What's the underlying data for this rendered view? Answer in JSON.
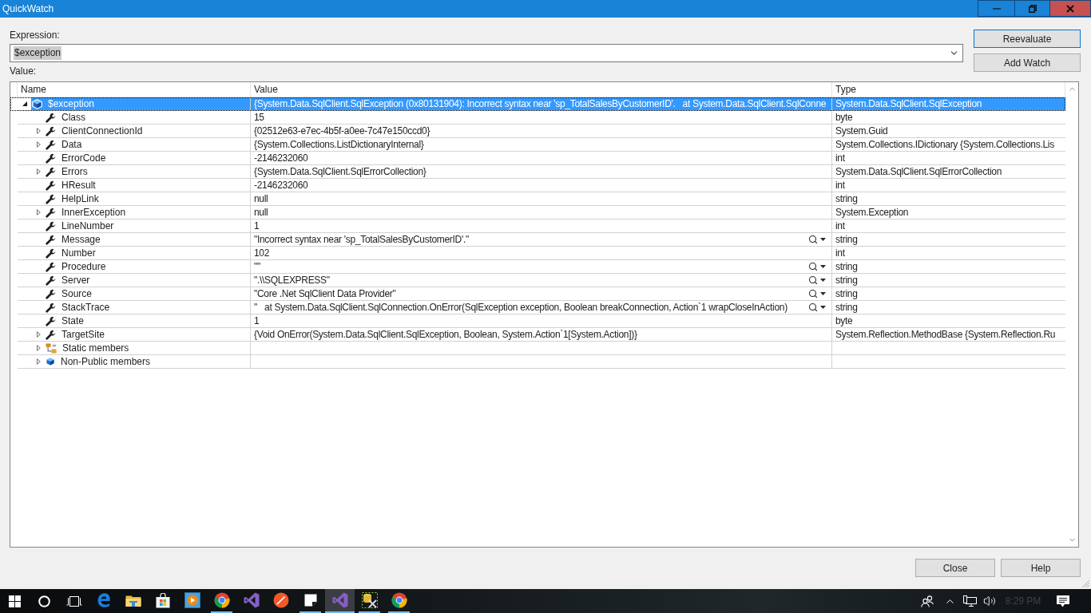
{
  "window": {
    "title": "QuickWatch"
  },
  "expression": {
    "label": "Expression:",
    "value": "$exception",
    "value_selected": true
  },
  "actions": [
    {
      "label": "Reevaluate",
      "default": true
    },
    {
      "label": "Add Watch",
      "default": false
    }
  ],
  "value_label": "Value:",
  "grid": {
    "columns": [
      "Name",
      "Value",
      "Type"
    ],
    "rows": [
      {
        "name": "$exception",
        "value": "{System.Data.SqlClient.SqlException (0x80131904): Incorrect syntax near 'sp_TotalSalesByCustomerID'.   at System.Data.SqlClient.SqlConne",
        "type": "System.Data.SqlClient.SqlException",
        "kind": "exception",
        "expandable": true,
        "expanded": true,
        "selected": true,
        "visualizer": false,
        "children": [
          {
            "name": "Class",
            "value": "15",
            "type": "byte",
            "kind": "property",
            "expandable": false,
            "selected": false,
            "visualizer": false
          },
          {
            "name": "ClientConnectionId",
            "value": "{02512e63-e7ec-4b5f-a0ee-7c47e150ccd0}",
            "type": "System.Guid",
            "kind": "property",
            "expandable": true,
            "expanded": false,
            "selected": false,
            "visualizer": false
          },
          {
            "name": "Data",
            "value": "{System.Collections.ListDictionaryInternal}",
            "type": "System.Collections.IDictionary {System.Collections.Lis",
            "kind": "property",
            "expandable": true,
            "expanded": false,
            "selected": false,
            "visualizer": false
          },
          {
            "name": "ErrorCode",
            "value": "-2146232060",
            "type": "int",
            "kind": "property",
            "expandable": false,
            "selected": false,
            "visualizer": false
          },
          {
            "name": "Errors",
            "value": "{System.Data.SqlClient.SqlErrorCollection}",
            "type": "System.Data.SqlClient.SqlErrorCollection",
            "kind": "property",
            "expandable": true,
            "expanded": false,
            "selected": false,
            "visualizer": false
          },
          {
            "name": "HResult",
            "value": "-2146232060",
            "type": "int",
            "kind": "property",
            "expandable": false,
            "selected": false,
            "visualizer": false
          },
          {
            "name": "HelpLink",
            "value": "null",
            "type": "string",
            "kind": "property",
            "expandable": false,
            "selected": false,
            "visualizer": false
          },
          {
            "name": "InnerException",
            "value": "null",
            "type": "System.Exception",
            "kind": "property",
            "expandable": true,
            "expanded": false,
            "selected": false,
            "visualizer": false
          },
          {
            "name": "LineNumber",
            "value": "1",
            "type": "int",
            "kind": "property",
            "expandable": false,
            "selected": false,
            "visualizer": false
          },
          {
            "name": "Message",
            "value": "\"Incorrect syntax near 'sp_TotalSalesByCustomerID'.\"",
            "type": "string",
            "kind": "property",
            "expandable": false,
            "selected": false,
            "visualizer": true
          },
          {
            "name": "Number",
            "value": "102",
            "type": "int",
            "kind": "property",
            "expandable": false,
            "selected": false,
            "visualizer": false
          },
          {
            "name": "Procedure",
            "value": "\"\"",
            "type": "string",
            "kind": "property",
            "expandable": false,
            "selected": false,
            "visualizer": true
          },
          {
            "name": "Server",
            "value": "\".\\\\SQLEXPRESS\"",
            "type": "string",
            "kind": "property",
            "expandable": false,
            "selected": false,
            "visualizer": true
          },
          {
            "name": "Source",
            "value": "\"Core .Net SqlClient Data Provider\"",
            "type": "string",
            "kind": "property",
            "expandable": false,
            "selected": false,
            "visualizer": true
          },
          {
            "name": "StackTrace",
            "value": "\"   at System.Data.SqlClient.SqlConnection.OnError(SqlException exception, Boolean breakConnection, Action`1 wrapCloseInAction)",
            "type": "string",
            "kind": "property",
            "expandable": false,
            "selected": false,
            "visualizer": true
          },
          {
            "name": "State",
            "value": "1",
            "type": "byte",
            "kind": "property",
            "expandable": false,
            "selected": false,
            "visualizer": false
          },
          {
            "name": "TargetSite",
            "value": "{Void OnError(System.Data.SqlClient.SqlException, Boolean, System.Action`1[System.Action])}",
            "type": "System.Reflection.MethodBase {System.Reflection.Ru",
            "kind": "property",
            "expandable": true,
            "expanded": false,
            "selected": false,
            "visualizer": false
          },
          {
            "name": "Static members",
            "kind": "static",
            "expandable": true,
            "expanded": false,
            "selected": false,
            "visualizer": false
          },
          {
            "name": "Non-Public members",
            "kind": "nonpublic",
            "expandable": true,
            "expanded": false,
            "selected": false,
            "visualizer": false
          }
        ]
      }
    ]
  },
  "dialog_buttons": [
    "Close",
    "Help"
  ],
  "taskbar": {
    "apps": [
      {
        "kind": "edge",
        "running": false,
        "active": false
      },
      {
        "kind": "explorer",
        "running": false,
        "active": false
      },
      {
        "kind": "store",
        "running": false,
        "active": false
      },
      {
        "kind": "player",
        "running": false,
        "active": false
      },
      {
        "kind": "chrome",
        "running": true,
        "active": false
      },
      {
        "kind": "vs",
        "running": false,
        "active": false
      },
      {
        "kind": "pen",
        "running": false,
        "active": false
      },
      {
        "kind": "notes",
        "running": true,
        "active": false
      },
      {
        "kind": "vs",
        "running": true,
        "active": true
      },
      {
        "kind": "tools",
        "running": true,
        "active": false
      },
      {
        "kind": "chrome",
        "running": true,
        "active": false
      }
    ],
    "clock": "8:29 PM"
  }
}
